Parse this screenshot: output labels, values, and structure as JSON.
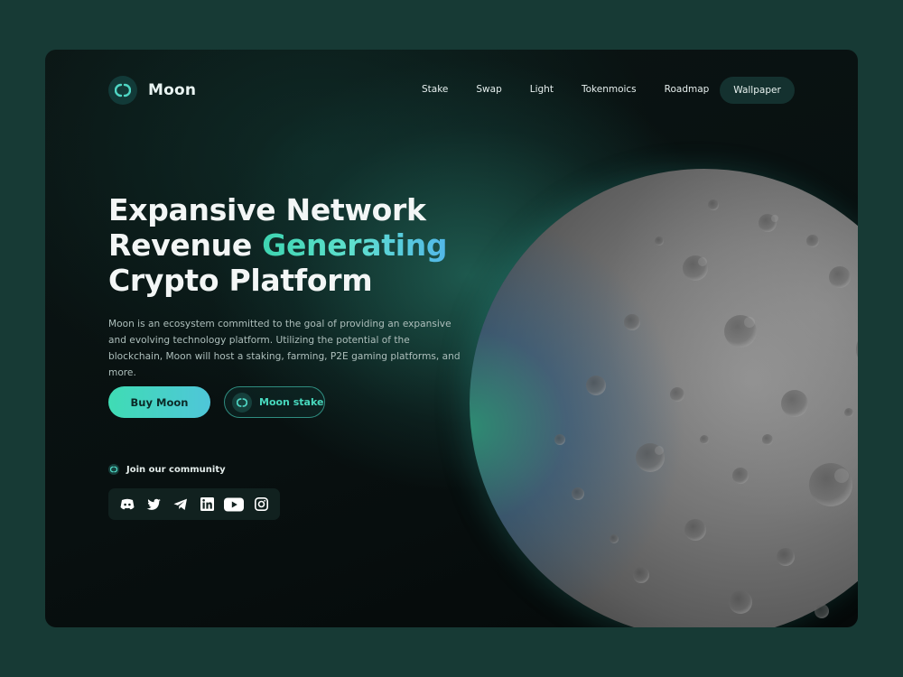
{
  "brand": {
    "name": "Moon",
    "logo_icon": "moon-logo-icon"
  },
  "nav": {
    "items": [
      {
        "label": "Stake"
      },
      {
        "label": "Swap"
      },
      {
        "label": "Light"
      },
      {
        "label": "Tokenmoics"
      },
      {
        "label": "Roadmap"
      }
    ],
    "cta_label": "Wallpaper"
  },
  "hero": {
    "headline_line1": "Expansive Network",
    "headline_line2_prefix": "Revenue ",
    "headline_highlight": "Generating",
    "headline_line3": "Crypto Platform",
    "description": "Moon is an ecosystem committed to the goal of providing an expansive and evolving technology platform. Utilizing the potential of the blockchain, Moon will host a staking, farming, P2E gaming platforms, and more.",
    "buy_label": "Buy Moon",
    "stake_label": "Moon stake"
  },
  "community": {
    "label": "Join our community",
    "socials": [
      "discord-icon",
      "twitter-icon",
      "telegram-icon",
      "linkedin-icon",
      "youtube-icon",
      "instagram-icon"
    ]
  },
  "colors": {
    "accent": "#3fdcb4",
    "accent_blue": "#4fc6d9",
    "page_bg": "#173a35",
    "panel_bg": "#081010"
  }
}
